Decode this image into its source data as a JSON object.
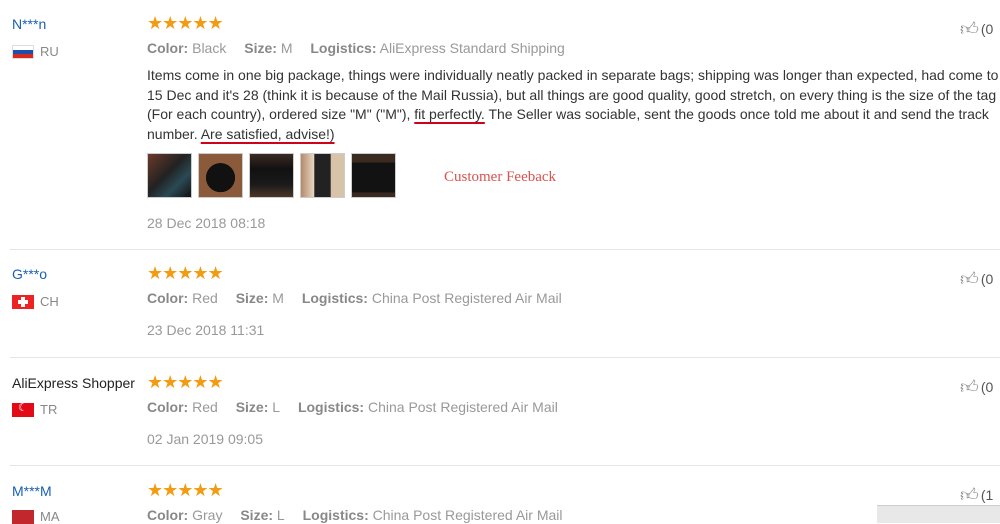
{
  "reviews": [
    {
      "user": "N***n",
      "country": "RU",
      "flag": "russia-flag-icon",
      "stars": "★★★★★",
      "color_label": "Color:",
      "color_value": "Black",
      "size_label": "Size:",
      "size_value": "M",
      "logistics_label": "Logistics:",
      "logistics_value": "AliExpress Standard Shipping",
      "text_a": "Items come in one big package, things were individually neatly packed in separate bags; shipping was longer than expected, had come to 15 Dec and it's 28 (think it is because of the Mail Russia), but all things are good quality, good stretch, on every thing is the size of the tag (For each country), ordered size \"M\" (\"M\"), ",
      "text_b": "fit perfectly.",
      "text_c": " The Seller was sociable, sent the goods once told me about it and send the track number. ",
      "text_d": "Are satisfied, advise!)",
      "annotation": "Customer Feeback",
      "date": "28 Dec 2018 08:18",
      "helpful": "(0"
    },
    {
      "user": "G***o",
      "country": "CH",
      "flag": "switzerland-flag-icon",
      "stars": "★★★★★",
      "color_label": "Color:",
      "color_value": "Red",
      "size_label": "Size:",
      "size_value": "M",
      "logistics_label": "Logistics:",
      "logistics_value": "China Post Registered Air Mail",
      "date": "23 Dec 2018 11:31",
      "helpful": "(0"
    },
    {
      "user": "AliExpress Shopper",
      "country": "TR",
      "flag": "turkey-flag-icon",
      "stars": "★★★★★",
      "color_label": "Color:",
      "color_value": "Red",
      "size_label": "Size:",
      "size_value": "L",
      "logistics_label": "Logistics:",
      "logistics_value": "China Post Registered Air Mail",
      "date": "02 Jan 2019 09:05",
      "helpful": "(0"
    },
    {
      "user": "M***M",
      "country": "MA",
      "flag": "morocco-flag-icon",
      "stars": "★★★★★",
      "color_label": "Color:",
      "color_value": "Gray",
      "size_label": "Size:",
      "size_value": "L",
      "logistics_label": "Logistics:",
      "logistics_value": "China Post Registered Air Mail",
      "helpful": "(1"
    }
  ]
}
